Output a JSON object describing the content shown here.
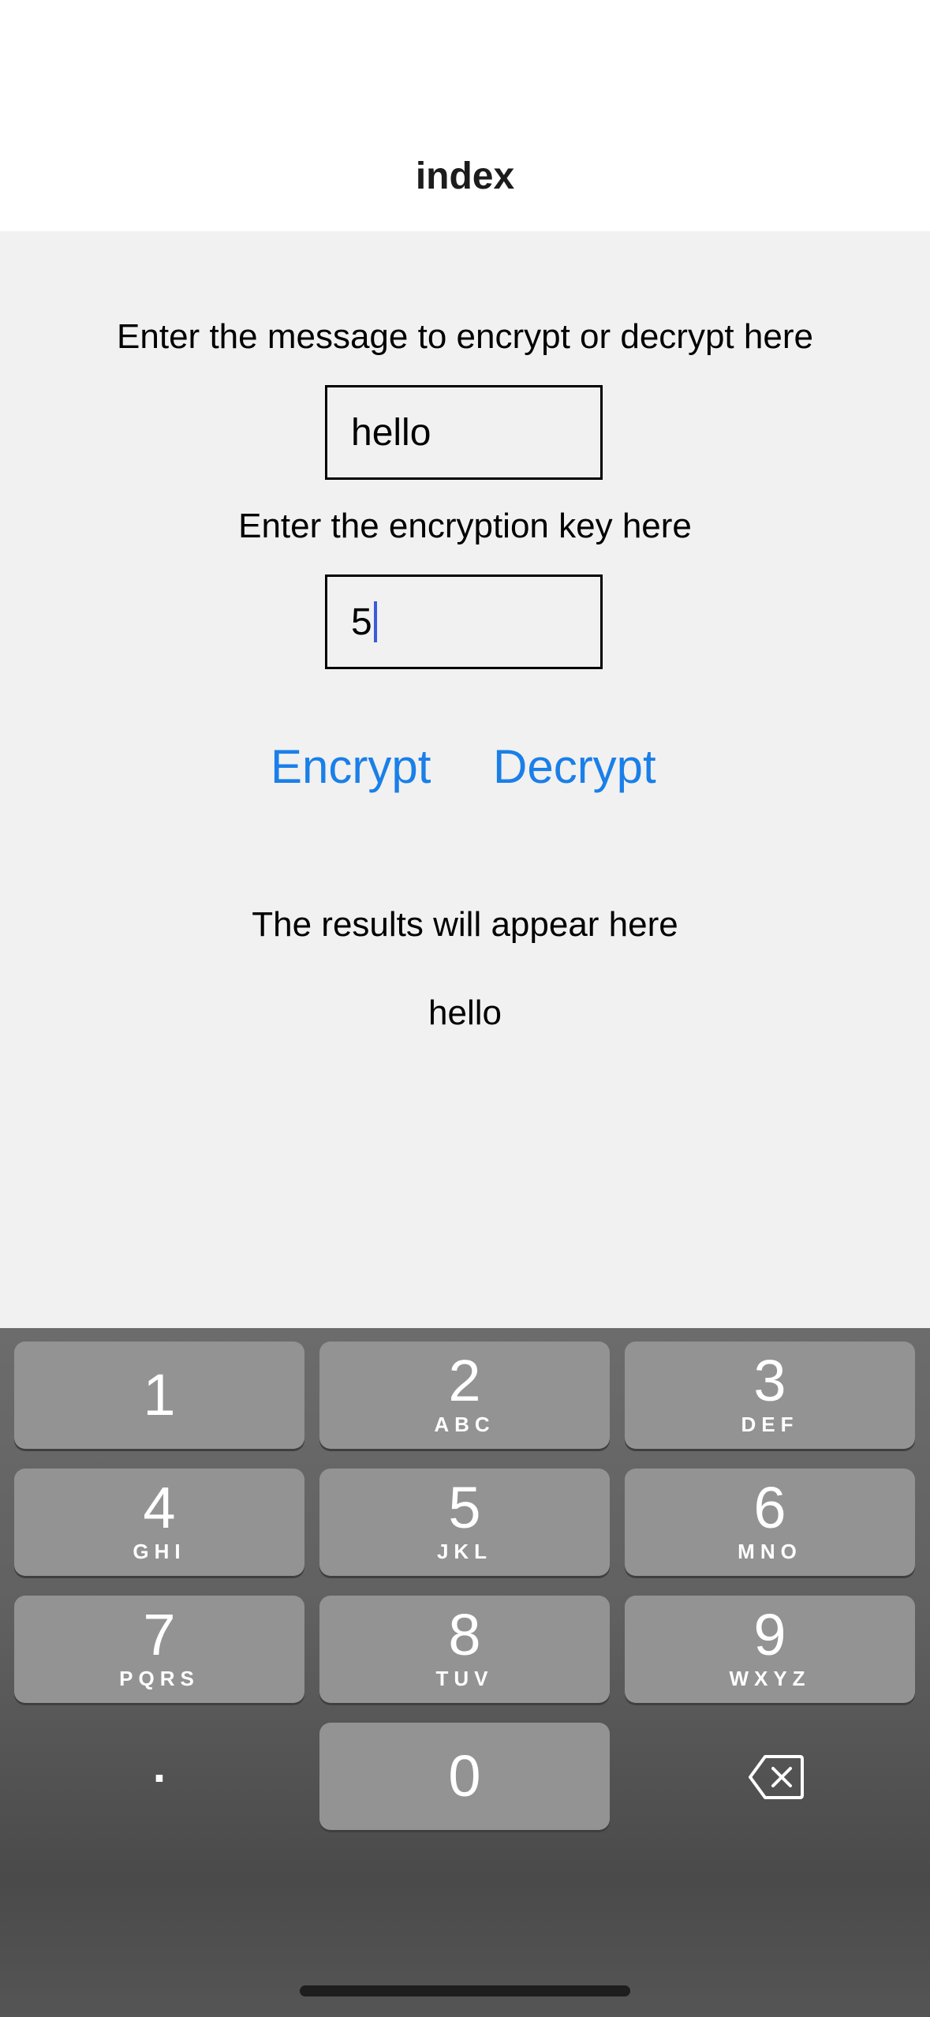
{
  "header": {
    "title": "index"
  },
  "message": {
    "label": "Enter the message to encrypt or decrypt here",
    "value": "hello"
  },
  "key": {
    "label": "Enter the encryption key here",
    "value": "5"
  },
  "actions": {
    "encrypt": "Encrypt",
    "decrypt": "Decrypt"
  },
  "results": {
    "label": "The results will appear here",
    "value": "hello"
  },
  "keyboard": {
    "keys": [
      {
        "num": "1",
        "letters": ""
      },
      {
        "num": "2",
        "letters": "ABC"
      },
      {
        "num": "3",
        "letters": "DEF"
      },
      {
        "num": "4",
        "letters": "GHI"
      },
      {
        "num": "5",
        "letters": "JKL"
      },
      {
        "num": "6",
        "letters": "MNO"
      },
      {
        "num": "7",
        "letters": "PQRS"
      },
      {
        "num": "8",
        "letters": "TUV"
      },
      {
        "num": "9",
        "letters": "WXYZ"
      },
      {
        "num": "0",
        "letters": ""
      }
    ],
    "decimal": ".",
    "delete_icon": "backspace-icon"
  },
  "colors": {
    "accent": "#1a7fe8",
    "caret": "#3b5bdb",
    "background": "#f1f1f1",
    "key": "#939393"
  }
}
